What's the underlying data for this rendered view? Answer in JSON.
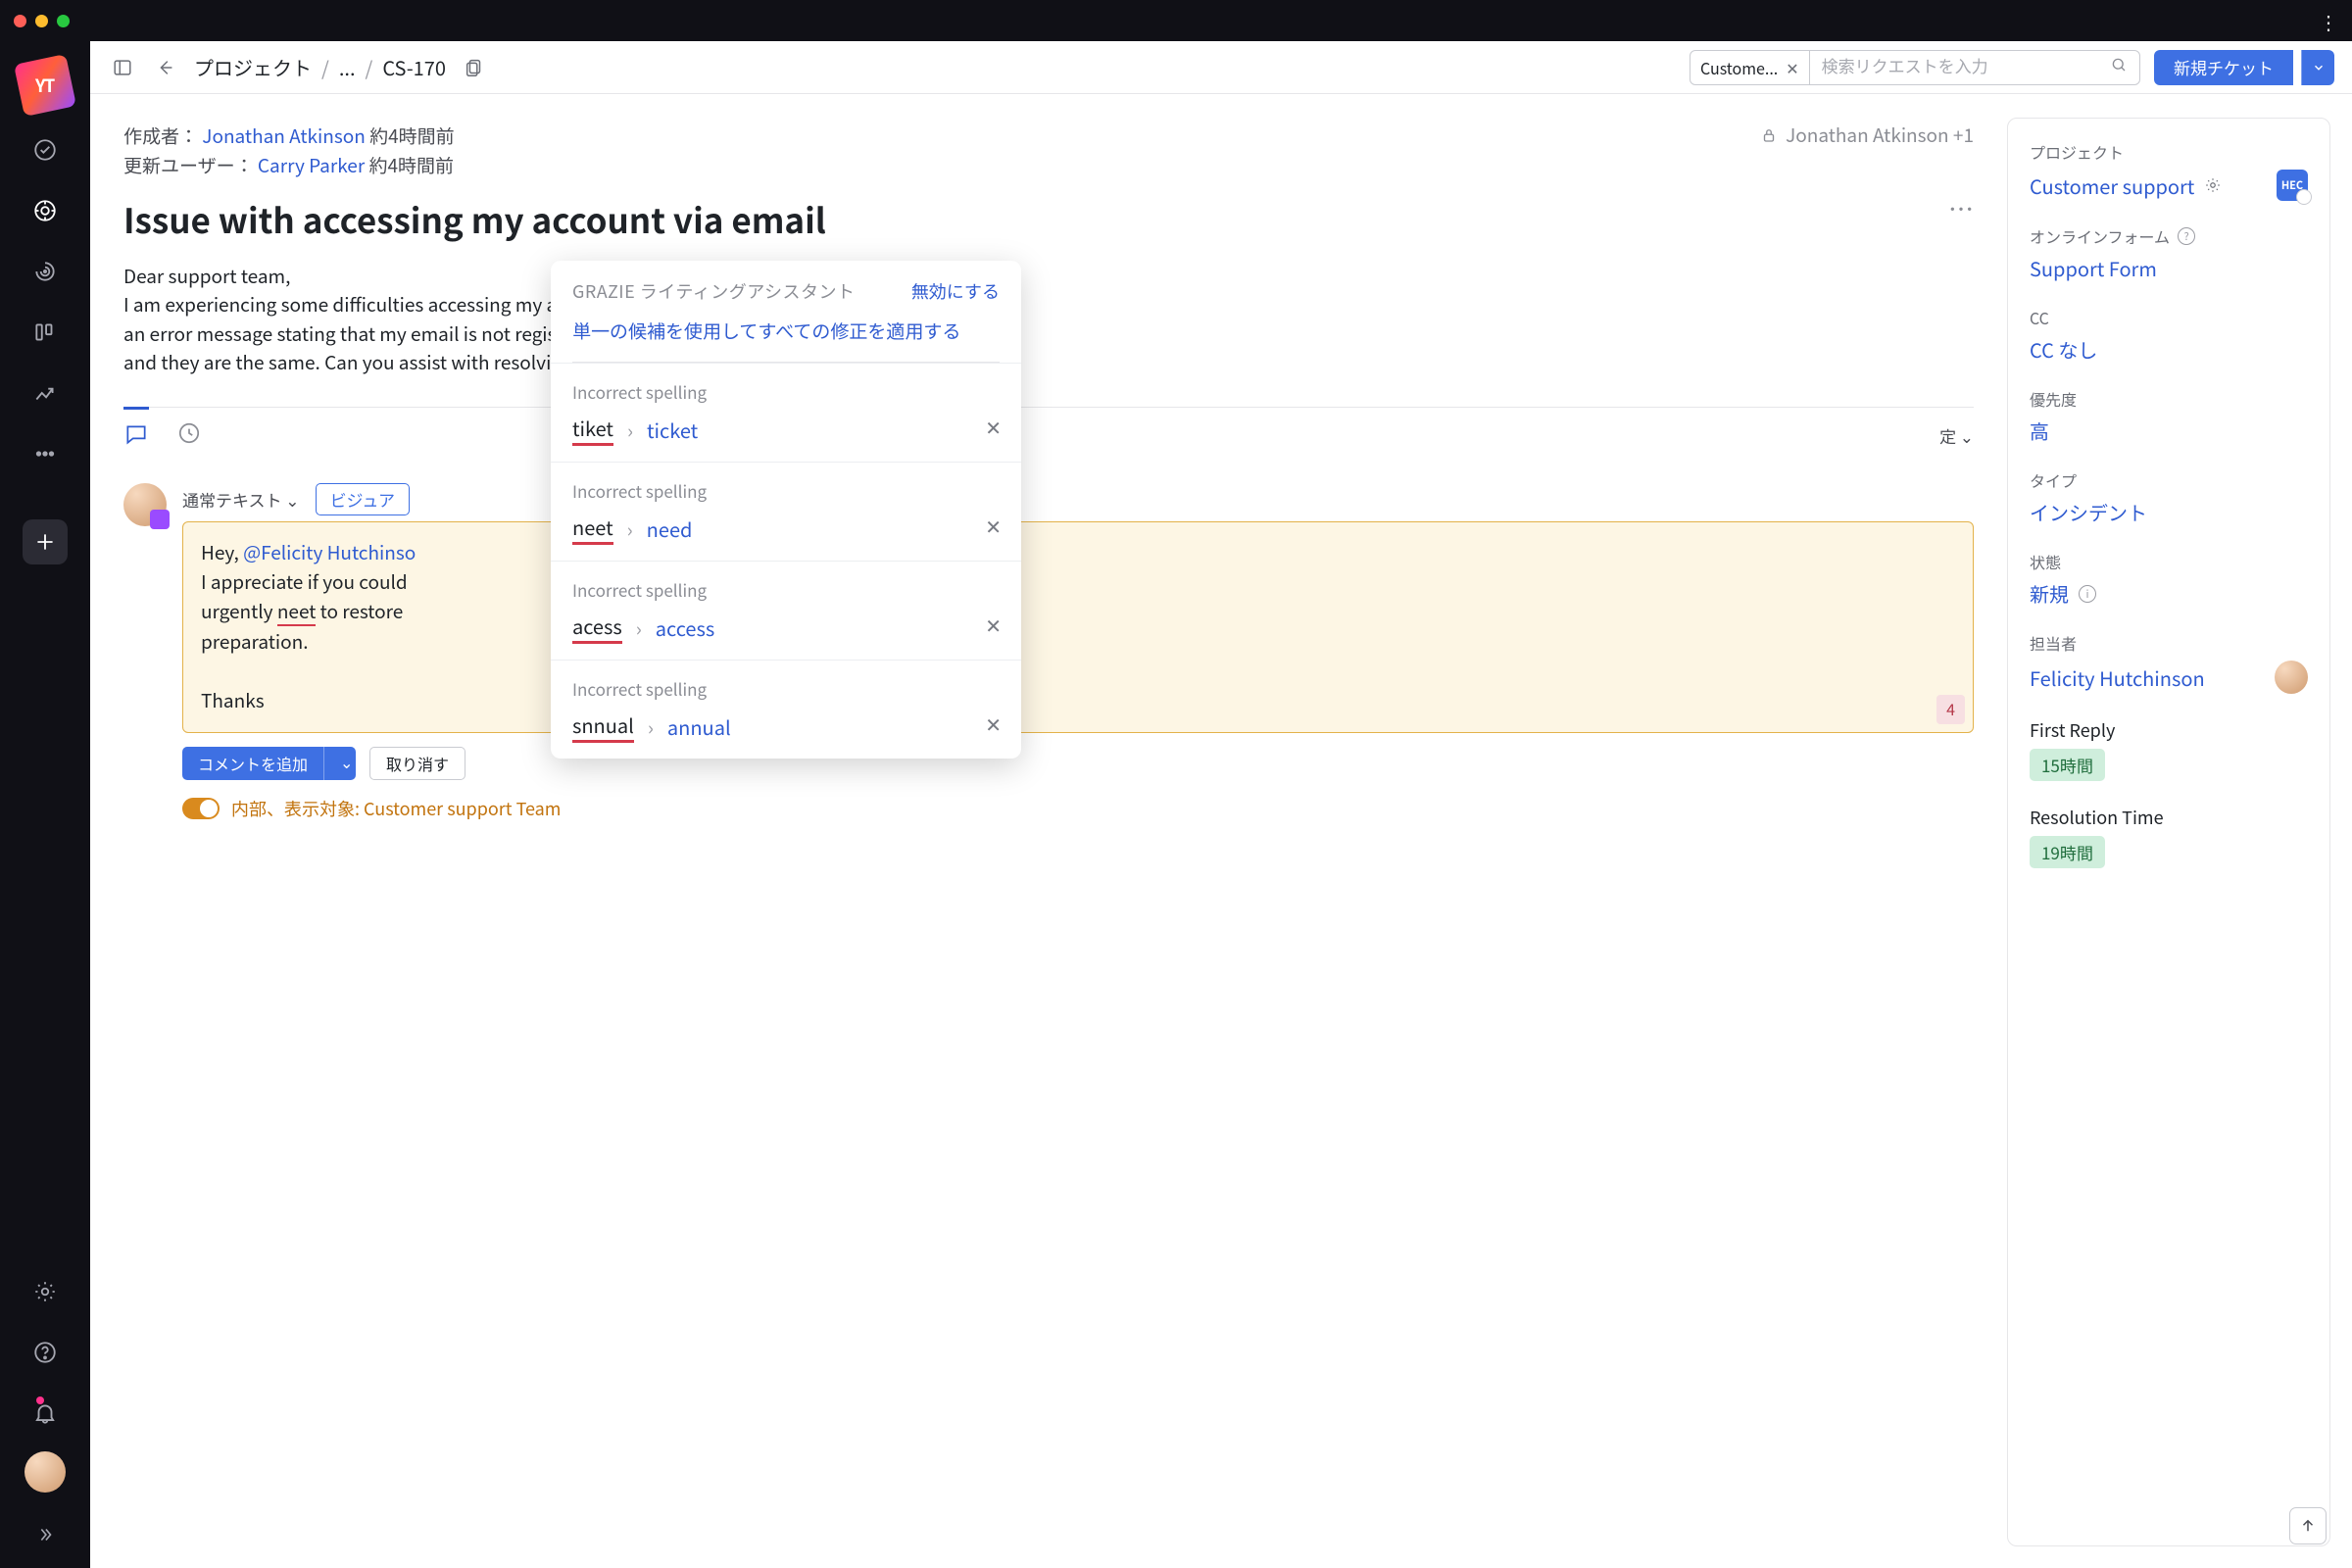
{
  "titlebar": {
    "kebab": "⋮"
  },
  "rail": {
    "logo": "YT"
  },
  "toolbar": {
    "breadcrumb": {
      "projects": "プロジェクト",
      "mid": "...",
      "ticket": "CS-170"
    },
    "search_chip": "Custome...",
    "search_placeholder": "検索リクエストを入力",
    "new_ticket": "新規チケット"
  },
  "meta": {
    "created_label": "作成者：",
    "created_by": "Jonathan Atkinson",
    "created_time": "約4時間前",
    "updated_label": "更新ユーザー：",
    "updated_by": "Carry Parker",
    "updated_time": "約4時間前",
    "visibility": "Jonathan Atkinson +1"
  },
  "ticket": {
    "title": "Issue with accessing my account via email",
    "body_open": "Dear support team,",
    "body_rest": "I am experiencing some difficulties accessing my account. Every time I try to log in, I receive an error message stating that my email is not registered. I double-checked my credentials and they are the same. Can you assist with resolving this issue as soon as possible?",
    "actions_more": "…"
  },
  "tabs": {
    "right_label": "定 ⌄"
  },
  "editor": {
    "toolbar_text": "通常テキスト",
    "mode": "ビジュア",
    "line1_pre": "Hey, ",
    "mention": "@Felicity Hutchinso",
    "line2": "I appreciate if you could",
    "line3_pre": "urgently ",
    "line3_err": "neet",
    "line3_post": " to restore",
    "line4": "preparation.",
    "line5": "Thanks",
    "err_count": "4"
  },
  "buttons": {
    "add_comment": "コメントを追加",
    "cancel": "取り消す"
  },
  "internal": {
    "label": "内部、表示対象: Customer support Team"
  },
  "aside": {
    "project_label": "プロジェクト",
    "project_value": "Customer support",
    "project_badge": "HEC",
    "form_label": "オンラインフォーム",
    "form_value": "Support Form",
    "cc_label": "CC",
    "cc_value": "CC なし",
    "priority_label": "優先度",
    "priority_value": "高",
    "type_label": "タイプ",
    "type_value": "インシデント",
    "state_label": "状態",
    "state_value": "新規",
    "assignee_label": "担当者",
    "assignee_value": "Felicity Hutchinson",
    "first_reply_label": "First Reply",
    "first_reply_value": "15時間",
    "resolution_label": "Resolution Time",
    "resolution_value": "19時間"
  },
  "grazie": {
    "title": "GRAZIE ライティングアシスタント",
    "disable": "無効にする",
    "apply_all": "単一の候補を使用してすべての修正を適用する",
    "sugg_label": "Incorrect spelling",
    "items": [
      {
        "bad": "tiket",
        "good": "ticket"
      },
      {
        "bad": "neet",
        "good": "need"
      },
      {
        "bad": "acess",
        "good": "access"
      },
      {
        "bad": "snnual",
        "good": "annual"
      }
    ]
  }
}
